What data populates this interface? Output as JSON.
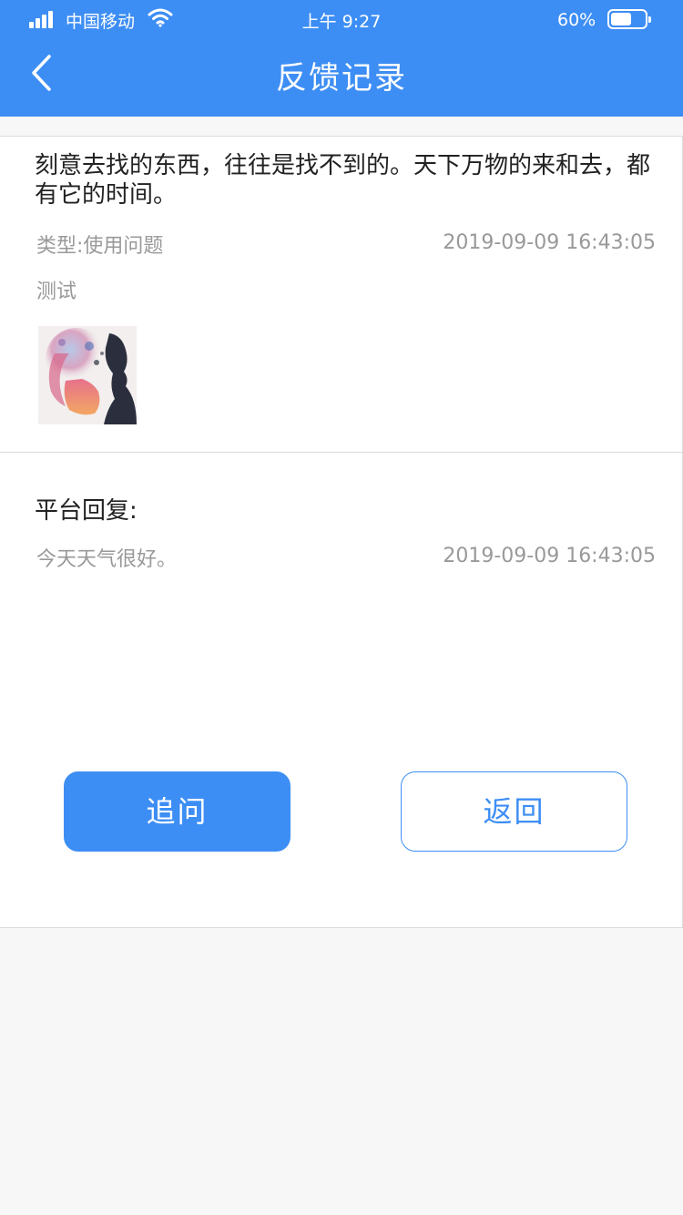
{
  "status_bar": {
    "carrier": "中国移动",
    "time": "上午 9:27",
    "battery": "60%",
    "battery_level": 0.6
  },
  "header": {
    "title": "反馈记录",
    "back_icon": "chevron-left-icon"
  },
  "feedback": {
    "content": "刻意去找的东西，往往是找不到的。天下万物的来和去，都有它的时间。",
    "type": "类型:使用问题",
    "datetime": "2019-09-09   16:43:05",
    "remark": "测试",
    "image": "attached-image"
  },
  "reply": {
    "label": "平台回复:",
    "content": "今天天气很好。",
    "datetime": "2019-09-09   16:43:05"
  },
  "buttons": {
    "ask": "追问",
    "return": "返回"
  },
  "colors": {
    "accent": "#3d8ef4",
    "muted_text": "#999999",
    "page_bg": "#f7f7f7"
  }
}
